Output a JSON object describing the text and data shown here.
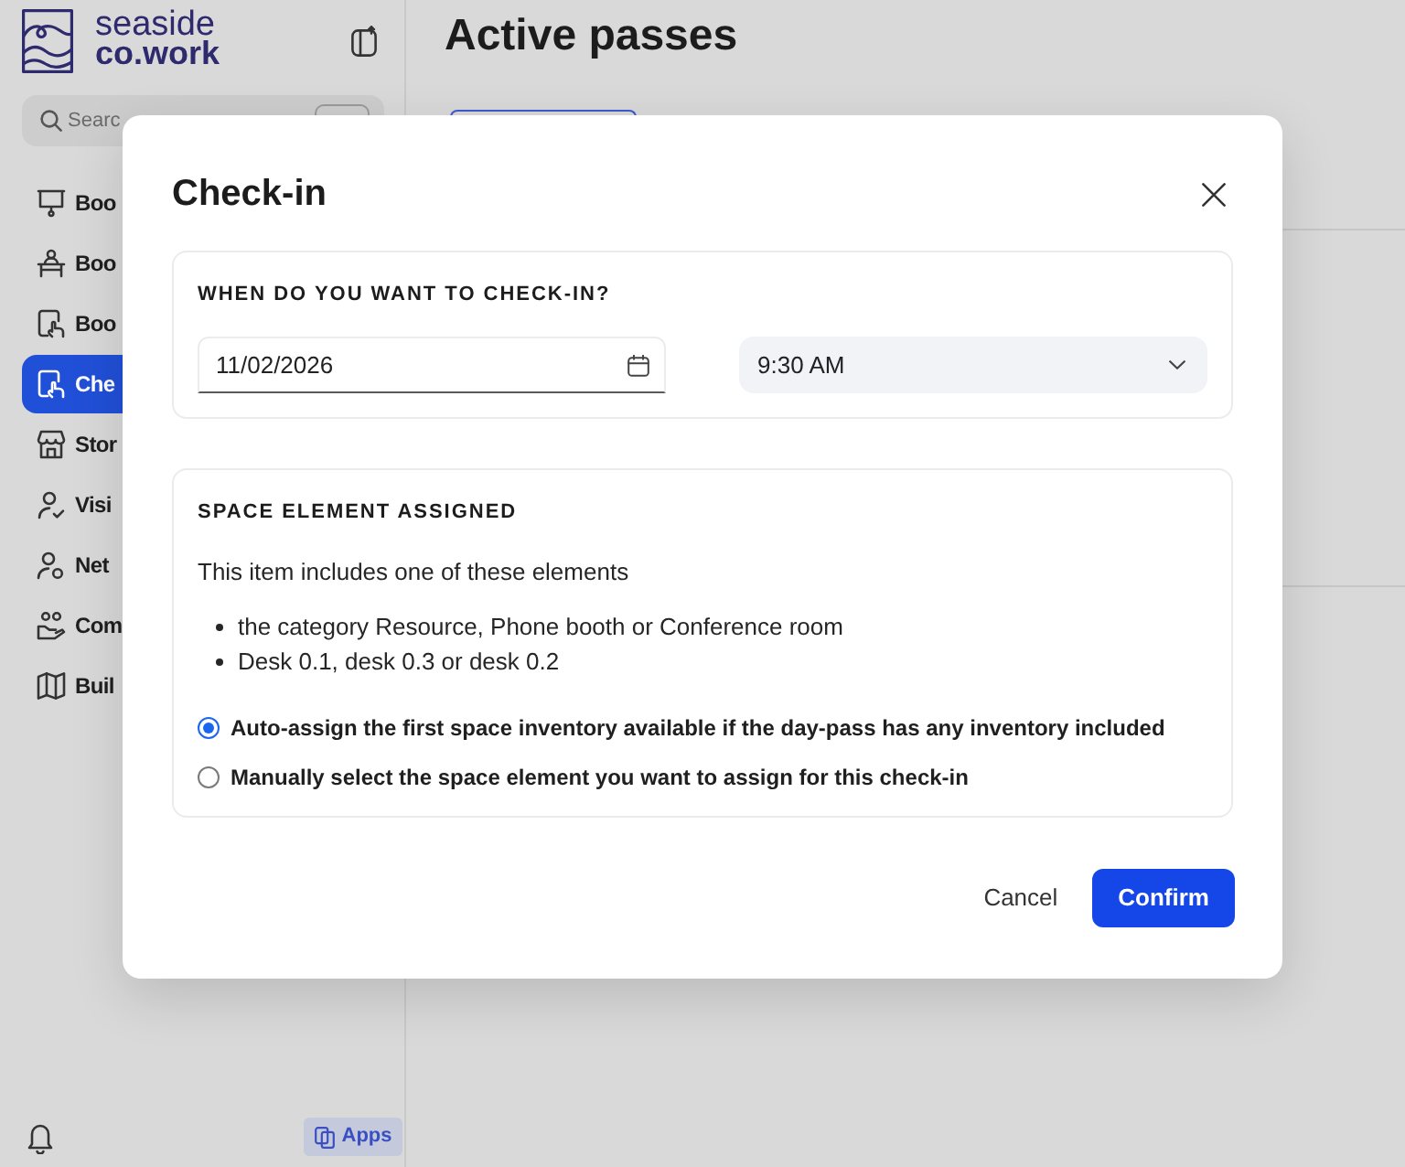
{
  "sidebar": {
    "logo": {
      "line_1": "seaside",
      "line_2": "co.work"
    },
    "search": {
      "placeholder": "Searc"
    },
    "nav_items": [
      {
        "label": "Boo",
        "selected": false
      },
      {
        "label": "Boo",
        "selected": false
      },
      {
        "label": "Boo",
        "selected": false
      },
      {
        "label": "Che",
        "selected": true
      },
      {
        "label": "Stor",
        "selected": false
      },
      {
        "label": "Visi",
        "selected": false
      },
      {
        "label": "Net",
        "selected": false
      },
      {
        "label": "Com",
        "selected": false
      },
      {
        "label": "Buil",
        "selected": false
      }
    ],
    "apps_button": {
      "label": "Apps"
    }
  },
  "page": {
    "title": "Active passes"
  },
  "dialog": {
    "title": "Check-in",
    "when_section": {
      "heading": "WHEN DO YOU WANT TO CHECK-IN?",
      "date": {
        "value": "11/02/2026"
      },
      "time": {
        "value": "9:30 AM"
      }
    },
    "space_section": {
      "heading": "SPACE ELEMENT ASSIGNED",
      "intro": "This item includes one of these elements",
      "elements": [
        "the category Resource, Phone booth or Conference room",
        "Desk 0.1, desk 0.3 or desk 0.2"
      ],
      "options": [
        {
          "label": "Auto-assign the first space inventory available if the day-pass has any inventory included",
          "selected": true
        },
        {
          "label": "Manually select the space element you want to assign for this check-in",
          "selected": false
        }
      ]
    },
    "buttons": [
      {
        "label": "Cancel",
        "kind": "secondary"
      },
      {
        "label": "Confirm",
        "kind": "primary"
      }
    ]
  }
}
